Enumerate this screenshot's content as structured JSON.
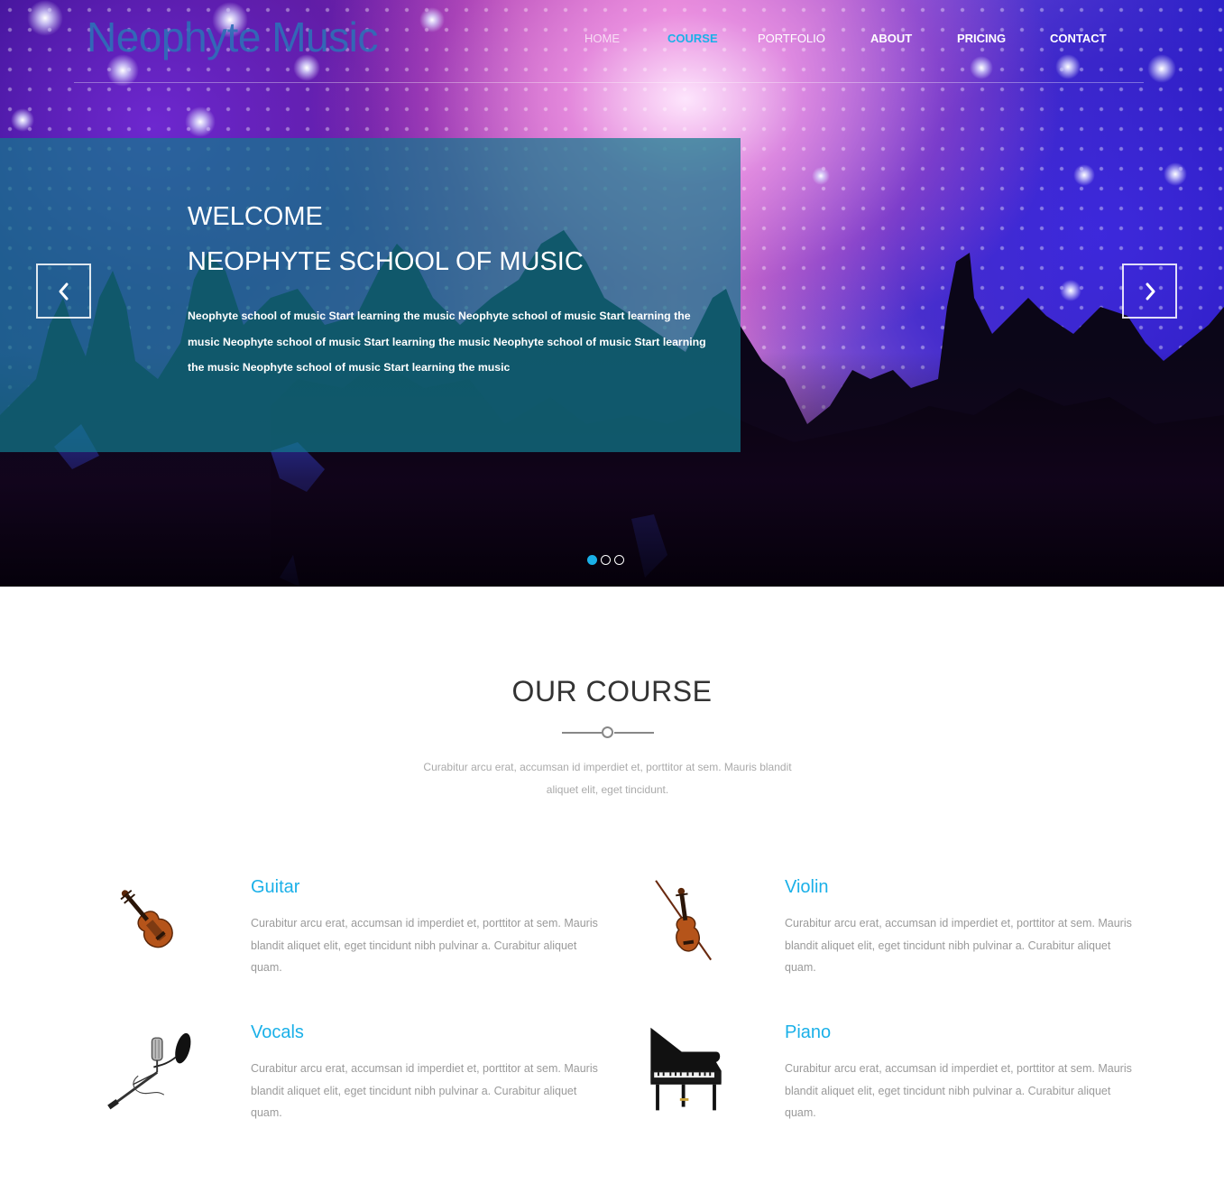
{
  "header": {
    "logo": "Neophyte Music",
    "nav": [
      "HOME",
      "COURSE",
      "PORTFOLIO",
      "ABOUT",
      "PRICING",
      "CONTACT"
    ],
    "active_nav": "COURSE"
  },
  "hero": {
    "title_line1": "WELCOME",
    "title_line2": "NEOPHYTE SCHOOL OF MUSIC",
    "body": "Neophyte school of music Start learning the music Neophyte school of music Start learning the music Neophyte school of music Start learning the music Neophyte school of music Start learning the music Neophyte school of music Start learning the music",
    "slide_count": 3,
    "active_slide": 1
  },
  "courses": {
    "title": "OUR COURSE",
    "subtitle": "Curabitur arcu erat, accumsan id imperdiet et, porttitor at sem. Mauris blandit aliquet elit, eget tincidunt.",
    "items": [
      {
        "name": "Guitar",
        "icon": "violin-icon",
        "desc": "Curabitur arcu erat, accumsan id imperdiet et, porttitor at sem. Mauris blandit aliquet elit, eget tincidunt nibh pulvinar a. Curabitur aliquet quam."
      },
      {
        "name": "Violin",
        "icon": "violin-with-bow-icon",
        "desc": "Curabitur arcu erat, accumsan id imperdiet et, porttitor at sem. Mauris blandit aliquet elit, eget tincidunt nibh pulvinar a. Curabitur aliquet quam."
      },
      {
        "name": "Vocals",
        "icon": "microphone-icon",
        "desc": "Curabitur arcu erat, accumsan id imperdiet et, porttitor at sem. Mauris blandit aliquet elit, eget tincidunt nibh pulvinar a. Curabitur aliquet quam."
      },
      {
        "name": "Piano",
        "icon": "grand-piano-icon",
        "desc": "Curabitur arcu erat, accumsan id imperdiet et, porttitor at sem. Mauris blandit aliquet elit, eget tincidunt nibh pulvinar a. Curabitur aliquet quam."
      }
    ]
  },
  "colors": {
    "accent": "#1ab0e8",
    "logo": "#2e6fb8",
    "panel": "#12788c",
    "heading": "#333333",
    "body_text": "#9a9a9a"
  }
}
